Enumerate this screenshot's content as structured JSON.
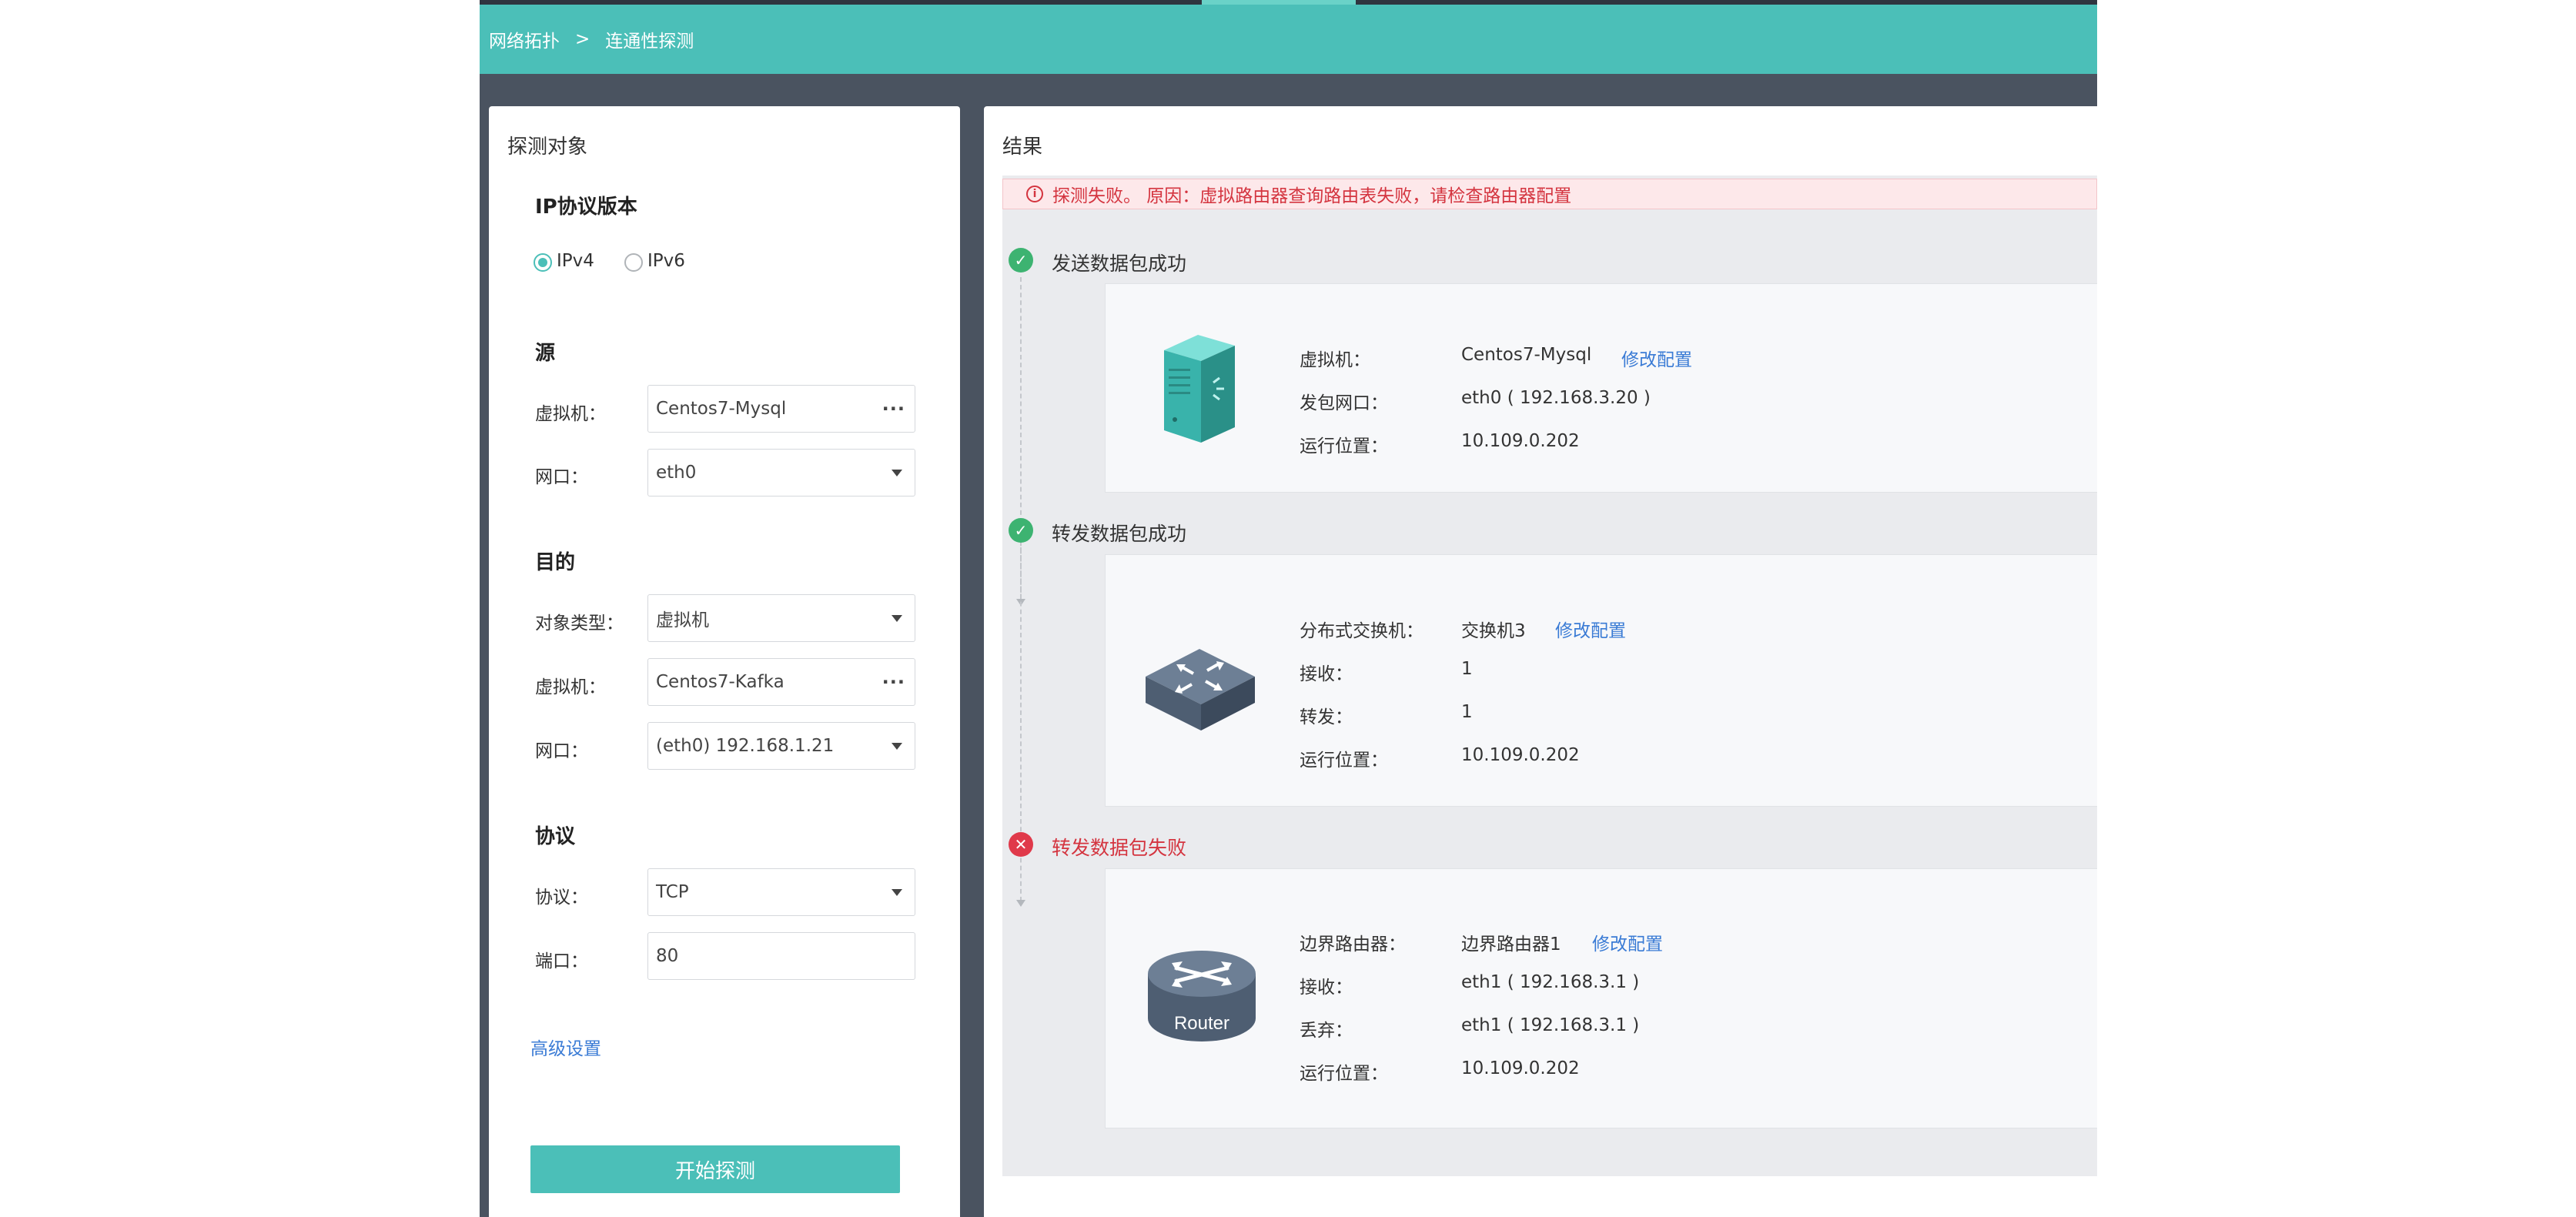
{
  "breadcrumb": {
    "root": "网络拓扑",
    "separator": ">",
    "current": "连通性探测"
  },
  "left": {
    "title": "探测对象",
    "ip_version": {
      "title": "IP协议版本",
      "options": [
        {
          "label": "IPv4",
          "checked": true
        },
        {
          "label": "IPv6",
          "checked": false
        }
      ]
    },
    "source": {
      "title": "源",
      "vm_label": "虚拟机：",
      "vm_value": "Centos7-Mysql",
      "port_label": "网口：",
      "port_value": "eth0"
    },
    "destination": {
      "title": "目的",
      "type_label": "对象类型：",
      "type_value": "虚拟机",
      "vm_label": "虚拟机：",
      "vm_value": "Centos7-Kafka",
      "port_label": "网口：",
      "port_value": "(eth0) 192.168.1.21"
    },
    "protocol": {
      "title": "协议",
      "proto_label": "协议：",
      "proto_value": "TCP",
      "port_label": "端口：",
      "port_value": "80"
    },
    "advanced_link": "高级设置",
    "start_button": "开始探测"
  },
  "right": {
    "title": "结果",
    "alert": "探测失败。 原因：虚拟路由器查询路由表失败，请检查路由器配置",
    "steps": [
      {
        "status": "success",
        "title": "发送数据包成功",
        "device_icon": "server-icon",
        "rows": [
          {
            "label": "虚拟机：",
            "value": "Centos7-Mysql",
            "link": "修改配置"
          },
          {
            "label": "发包网口：",
            "value": "eth0 ( 192.168.3.20 )"
          },
          {
            "label": "运行位置：",
            "value": "10.109.0.202"
          }
        ]
      },
      {
        "status": "success",
        "title": "转发数据包成功",
        "device_icon": "switch-icon",
        "rows": [
          {
            "label": "分布式交换机：",
            "value": "交换机3",
            "link": "修改配置"
          },
          {
            "label": "接收：",
            "value": "1"
          },
          {
            "label": "转发：",
            "value": "1"
          },
          {
            "label": "运行位置：",
            "value": "10.109.0.202"
          }
        ]
      },
      {
        "status": "fail",
        "title": "转发数据包失败",
        "device_icon": "router-icon",
        "device_caption": "Router",
        "rows": [
          {
            "label": "边界路由器：",
            "value": "边界路由器1",
            "link": "修改配置"
          },
          {
            "label": "接收：",
            "value": "eth1 ( 192.168.3.1 )"
          },
          {
            "label": "丢弃：",
            "value": "eth1 ( 192.168.3.1 )"
          },
          {
            "label": "运行位置：",
            "value": "10.109.0.202"
          }
        ]
      }
    ]
  },
  "colors": {
    "accent": "#4bbfb8",
    "success": "#3db371",
    "error": "#e0394a",
    "link": "#3a7bd5",
    "frame": "#4a5360"
  }
}
